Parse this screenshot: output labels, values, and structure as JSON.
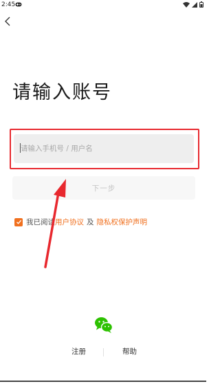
{
  "status_bar": {
    "time": "2:45",
    "icons": [
      "gamepad-icon",
      "wifi-icon",
      "signal-icon",
      "battery-icon"
    ]
  },
  "nav": {
    "back_icon": "chevron-left-icon"
  },
  "title": "请输入账号",
  "account_input": {
    "value": "",
    "placeholder": "请输入手机号 / 用户名"
  },
  "next_button": {
    "label": "下一步"
  },
  "agreement": {
    "checked": true,
    "prefix": "我已阅读",
    "user_agreement": "用户协议",
    "conjunction": "及",
    "privacy_statement": "隐私权保护声明"
  },
  "bottom": {
    "wechat_icon": "wechat-icon",
    "register_label": "注册",
    "help_label": "帮助"
  },
  "colors": {
    "accent": "#f0701f",
    "annotation_red": "#e8282e",
    "wechat_green": "#2dc100",
    "input_bg": "#eeeeee",
    "button_bg": "#f7f7f7"
  }
}
